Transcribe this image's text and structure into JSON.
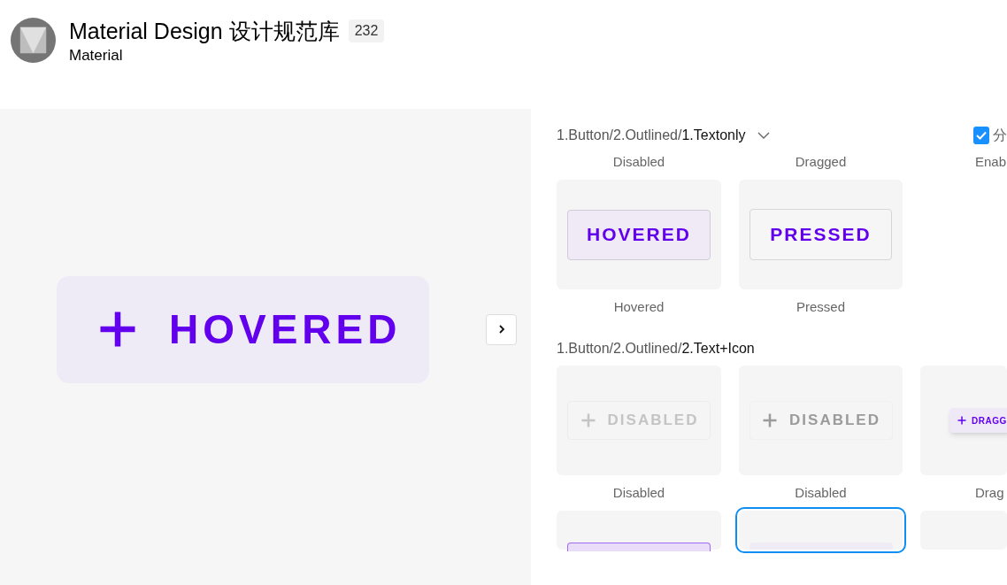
{
  "header": {
    "title": "Material Design 设计规范库",
    "count": "232",
    "subtitle": "Material"
  },
  "preview": {
    "label": "HOVERED",
    "kind": "hovered"
  },
  "filter": {
    "label": "分",
    "checked": true
  },
  "sections": [
    {
      "path_prefix": "1.Button/2.Outlined/",
      "path_leaf": "1.Textonly",
      "has_dropdown": true,
      "top_captions": [
        "Disabled",
        "Dragged",
        "Enab"
      ],
      "rows": [
        {
          "cards": [
            {
              "kind": "hovered",
              "label": "HOVERED",
              "icon": false,
              "selected": false,
              "caption": "Hovered"
            },
            {
              "kind": "pressed",
              "label": "PRESSED",
              "icon": false,
              "selected": false,
              "caption": "Pressed"
            }
          ]
        }
      ]
    },
    {
      "path_prefix": "1.Button/2.Outlined/",
      "path_leaf": "2.Text+Icon",
      "has_dropdown": false,
      "rows": [
        {
          "cards": [
            {
              "kind": "faint",
              "label": "DISABLED",
              "icon": true,
              "selected": false,
              "caption": "Disabled"
            },
            {
              "kind": "disabled",
              "label": "DISABLED",
              "icon": true,
              "selected": false,
              "caption": "Disabled"
            },
            {
              "kind": "dragged",
              "label": "DRAGG",
              "icon": true,
              "selected": false,
              "caption": "Drag"
            }
          ]
        },
        {
          "cards": [
            {
              "kind": "focused",
              "selected": false
            },
            {
              "kind": "hovered-empty",
              "selected": true
            },
            {
              "kind": "empty",
              "selected": false
            }
          ]
        }
      ]
    }
  ]
}
